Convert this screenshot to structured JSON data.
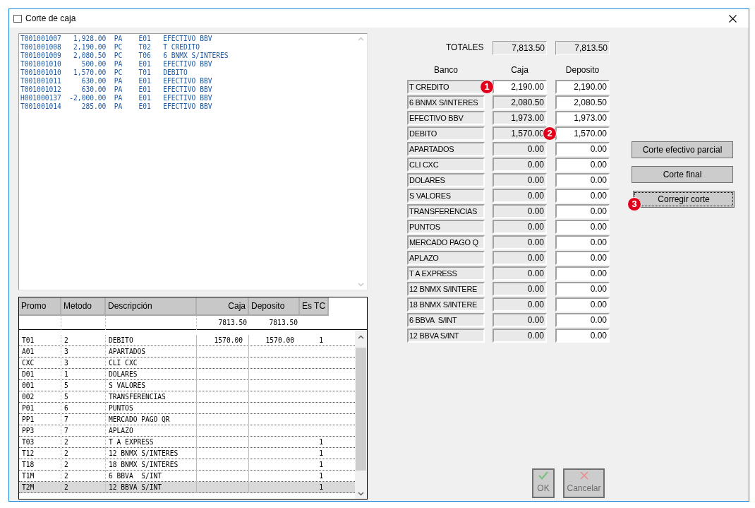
{
  "window": {
    "title": "Corte de caja"
  },
  "log": {
    "lines": [
      "T001001007   1,928.00  PA    E01   EFECTIVO BBV",
      "T001001008   2,190.00  PC    T02   T CREDITO",
      "T001001009   2,080.50  PC    T06   6 BNMX S/INTERES",
      "T001001010     500.00  PA    E01   EFECTIVO BBV",
      "T001001010   1,570.00  PC    T01   DEBITO",
      "T001001011     630.00  PA    E01   EFECTIVO BBV",
      "T001001012     630.00  PA    E01   EFECTIVO BBV",
      "H001000137  -2,000.00  PA    E01   EFECTIVO BBV",
      "T001001014     285.00  PA    E01   EFECTIVO BBV"
    ]
  },
  "grid": {
    "columns": [
      "Promo",
      "Metodo",
      "Descripción",
      "Caja",
      "Deposito",
      "Es TC"
    ],
    "totals": {
      "caja": "7813.50",
      "deposito": "7813.50"
    },
    "rows": [
      {
        "promo": "T01",
        "metodo": "2",
        "descripcion": "DEBITO",
        "caja": "1570.00",
        "deposito": "1570.00",
        "es_tc": "1",
        "selected": false
      },
      {
        "promo": "A01",
        "metodo": "3",
        "descripcion": "APARTADOS",
        "caja": "",
        "deposito": "",
        "es_tc": "",
        "selected": false
      },
      {
        "promo": "CXC",
        "metodo": "3",
        "descripcion": "CLI CXC",
        "caja": "",
        "deposito": "",
        "es_tc": "",
        "selected": false
      },
      {
        "promo": "D01",
        "metodo": "1",
        "descripcion": "DOLARES",
        "caja": "",
        "deposito": "",
        "es_tc": "",
        "selected": false
      },
      {
        "promo": "001",
        "metodo": "5",
        "descripcion": "S VALORES",
        "caja": "",
        "deposito": "",
        "es_tc": "",
        "selected": false
      },
      {
        "promo": "002",
        "metodo": "5",
        "descripcion": "TRANSFERENCIAS",
        "caja": "",
        "deposito": "",
        "es_tc": "",
        "selected": false
      },
      {
        "promo": "P01",
        "metodo": "6",
        "descripcion": "PUNTOS",
        "caja": "",
        "deposito": "",
        "es_tc": "",
        "selected": false
      },
      {
        "promo": "PP1",
        "metodo": "7",
        "descripcion": "MERCADO PAGO QR",
        "caja": "",
        "deposito": "",
        "es_tc": "",
        "selected": false
      },
      {
        "promo": "PP3",
        "metodo": "7",
        "descripcion": "APLAZO",
        "caja": "",
        "deposito": "",
        "es_tc": "",
        "selected": false
      },
      {
        "promo": "T03",
        "metodo": "2",
        "descripcion": "T A EXPRESS",
        "caja": "",
        "deposito": "",
        "es_tc": "1",
        "selected": false
      },
      {
        "promo": "T12",
        "metodo": "2",
        "descripcion": "12 BNMX S/INTERES",
        "caja": "",
        "deposito": "",
        "es_tc": "1",
        "selected": false
      },
      {
        "promo": "T18",
        "metodo": "2",
        "descripcion": "18 BNMX S/INTERES",
        "caja": "",
        "deposito": "",
        "es_tc": "1",
        "selected": false
      },
      {
        "promo": "T1M",
        "metodo": "2",
        "descripcion": "6 BBVA  S/INT",
        "caja": "",
        "deposito": "",
        "es_tc": "1",
        "selected": false
      },
      {
        "promo": "T2M",
        "metodo": "2",
        "descripcion": "12 BBVA S/INT",
        "caja": "",
        "deposito": "",
        "es_tc": "1",
        "selected": true
      }
    ]
  },
  "totals": {
    "label": "TOTALES",
    "caja": "7,813.50",
    "deposito": "7,813.50"
  },
  "banks": {
    "headers": [
      "Banco",
      "Caja",
      "Deposito"
    ],
    "rows": [
      {
        "banco": "T CREDITO",
        "caja": "2,190.00",
        "deposito": "2,190.00",
        "caja_active": true,
        "caja_badge": "1"
      },
      {
        "banco": "6 BNMX S/INTERES",
        "caja": "2,080.50",
        "deposito": "2,080.50",
        "caja_active": false
      },
      {
        "banco": "EFECTIVO BBV",
        "caja": "1,973.00",
        "deposito": "1,973.00",
        "caja_active": false
      },
      {
        "banco": "DEBITO",
        "caja": "1,570.00",
        "deposito": "1,570.00",
        "caja_active": false,
        "deposito_badge": "2"
      },
      {
        "banco": "APARTADOS",
        "caja": "0.00",
        "deposito": "0.00",
        "caja_active": false
      },
      {
        "banco": "CLI CXC",
        "caja": "0.00",
        "deposito": "0.00",
        "caja_active": false
      },
      {
        "banco": "DOLARES",
        "caja": "0.00",
        "deposito": "0.00",
        "caja_active": false
      },
      {
        "banco": "S VALORES",
        "caja": "0.00",
        "deposito": "0.00",
        "caja_active": false
      },
      {
        "banco": "TRANSFERENCIAS",
        "caja": "0.00",
        "deposito": "0.00",
        "caja_active": false
      },
      {
        "banco": "PUNTOS",
        "caja": "0.00",
        "deposito": "0.00",
        "caja_active": false
      },
      {
        "banco": "MERCADO PAGO Q",
        "caja": "0.00",
        "deposito": "0.00",
        "caja_active": false
      },
      {
        "banco": "APLAZO",
        "caja": "0.00",
        "deposito": "0.00",
        "caja_active": false
      },
      {
        "banco": "T A EXPRESS",
        "caja": "0.00",
        "deposito": "0.00",
        "caja_active": false
      },
      {
        "banco": "12 BNMX S/INTERE",
        "caja": "0.00",
        "deposito": "0.00",
        "caja_active": false
      },
      {
        "banco": "18 BNMX S/INTERE",
        "caja": "0.00",
        "deposito": "0.00",
        "caja_active": false
      },
      {
        "banco": "6 BBVA  S/INT",
        "caja": "0.00",
        "deposito": "0.00",
        "caja_active": false
      },
      {
        "banco": "12 BBVA S/INT",
        "caja": "0.00",
        "deposito": "0.00",
        "caja_active": false
      }
    ]
  },
  "buttons": [
    {
      "label": "Corte efectivo parcial",
      "focused": false
    },
    {
      "label": "Corte final",
      "focused": false
    },
    {
      "label": "Corregir corte",
      "focused": true,
      "badge": "3"
    }
  ],
  "dialog_buttons": [
    {
      "label": "OK",
      "kind": "ok",
      "disabled": true
    },
    {
      "label": "Cancelar",
      "kind": "cancel",
      "disabled": true
    }
  ]
}
